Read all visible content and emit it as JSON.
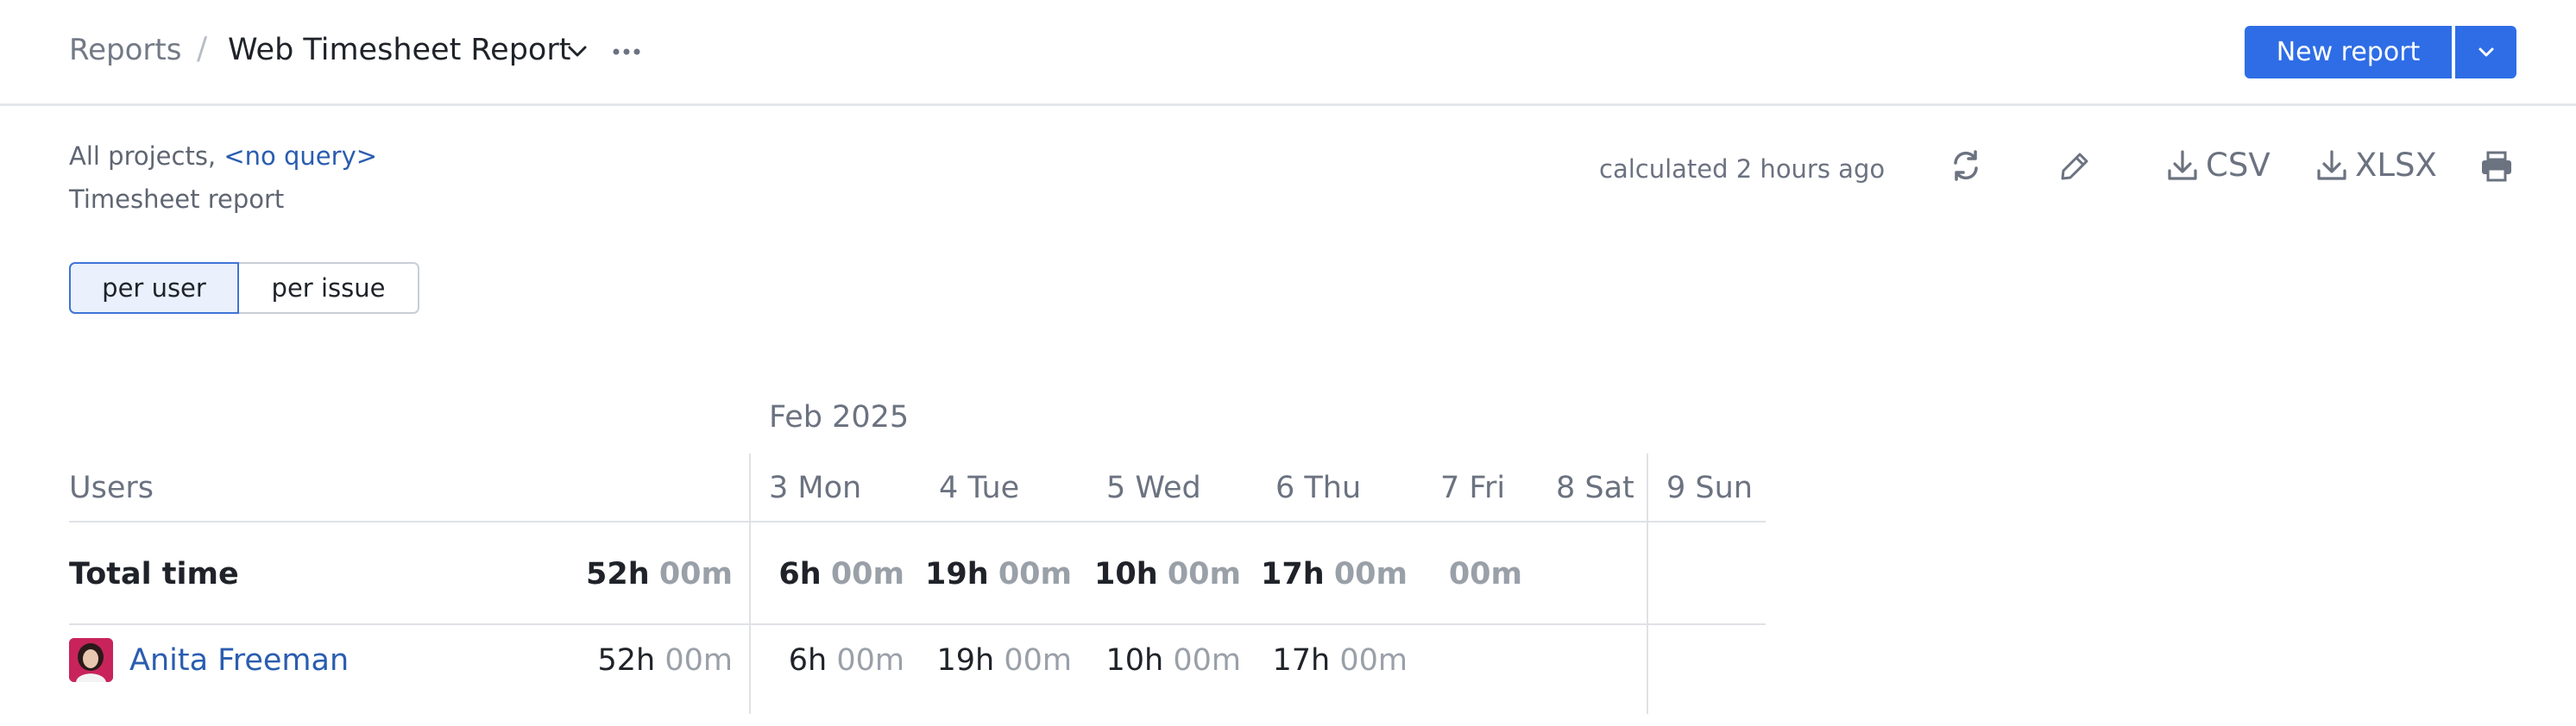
{
  "header": {
    "breadcrumb_root": "Reports",
    "breadcrumb_separator": "/",
    "report_title": "Web Timesheet Report",
    "new_report_label": "New report"
  },
  "info": {
    "scope_prefix": "All projects,",
    "scope_query": "<no query>",
    "report_type": "Timesheet report",
    "calculated": "calculated 2 hours ago"
  },
  "toolbar": {
    "csv_label": "CSV",
    "xlsx_label": "XLSX"
  },
  "view_toggle": {
    "per_user": "per user",
    "per_issue": "per issue",
    "selected": "per user"
  },
  "table": {
    "month": "Feb 2025",
    "users_header": "Users",
    "days": [
      "3 Mon",
      "4 Tue",
      "5 Wed",
      "6 Thu",
      "7 Fri",
      "8 Sat",
      "9 Sun"
    ],
    "total": {
      "label": "Total time",
      "sum": {
        "h": "52h",
        "m": "00m"
      },
      "days": [
        {
          "h": "6h",
          "m": "00m"
        },
        {
          "h": "19h",
          "m": "00m"
        },
        {
          "h": "10h",
          "m": "00m"
        },
        {
          "h": "17h",
          "m": "00m"
        },
        {
          "h": "",
          "m": "00m"
        },
        {
          "h": "",
          "m": ""
        },
        {
          "h": "",
          "m": ""
        }
      ]
    },
    "rows": [
      {
        "name": "Anita Freeman",
        "sum": {
          "h": "52h",
          "m": "00m"
        },
        "days": [
          {
            "h": "6h",
            "m": "00m"
          },
          {
            "h": "19h",
            "m": "00m"
          },
          {
            "h": "10h",
            "m": "00m"
          },
          {
            "h": "17h",
            "m": "00m"
          },
          {
            "h": "",
            "m": ""
          },
          {
            "h": "",
            "m": ""
          },
          {
            "h": "",
            "m": ""
          }
        ]
      }
    ]
  },
  "colors": {
    "accent": "#2e6de6",
    "link": "#2a5db0",
    "muted": "#6b7280",
    "avatar_bg": "#c8245b"
  },
  "icons": [
    "chevron-down-icon",
    "more-icon",
    "refresh-icon",
    "edit-icon",
    "download-icon",
    "print-icon"
  ]
}
